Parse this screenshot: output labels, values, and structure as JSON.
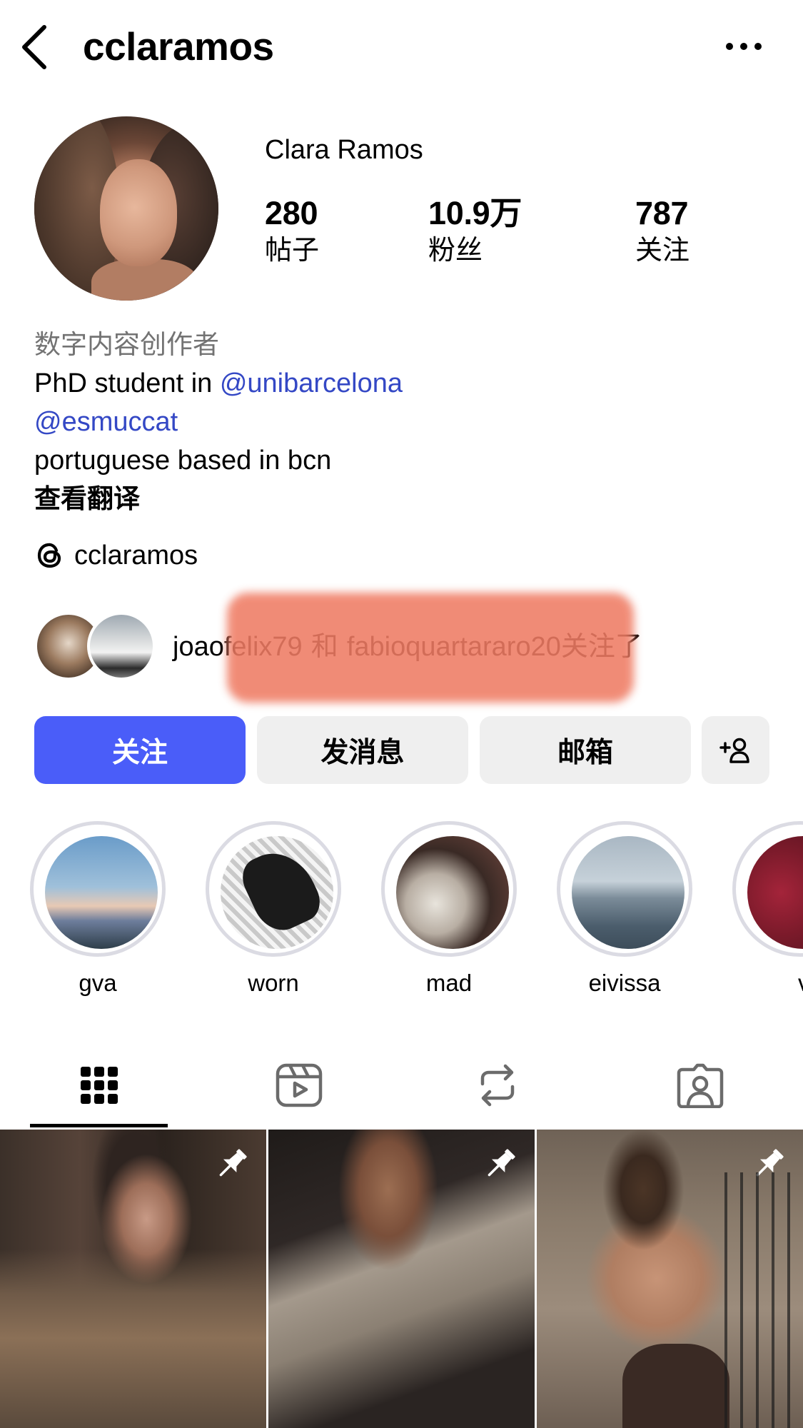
{
  "header": {
    "username": "cclaramos",
    "back_icon": "chevron-left-icon",
    "more_icon": "more-horizontal-icon"
  },
  "profile": {
    "display_name": "Clara Ramos",
    "stats": {
      "posts": {
        "value": "280",
        "label": "帖子"
      },
      "followers": {
        "value": "10.9万",
        "label": "粉丝"
      },
      "following": {
        "value": "787",
        "label": "关注"
      }
    }
  },
  "bio": {
    "category": "数字内容创作者",
    "line1_prefix": "PhD student in ",
    "mention1": "@unibarcelona",
    "mention2": "@esmuccat",
    "line3": "portuguese based in bcn",
    "translate": "查看翻译"
  },
  "threads": {
    "handle": "cclaramos",
    "icon": "threads-icon"
  },
  "followed_by": {
    "user1": "joaofelix79",
    "joiner": " 和 ",
    "user2": "fabioquartararo20",
    "suffix": "关注了"
  },
  "actions": {
    "follow": "关注",
    "message": "发消息",
    "email": "邮箱",
    "add_user_icon": "add-user-icon"
  },
  "highlights": [
    {
      "label": "gva"
    },
    {
      "label": "worn"
    },
    {
      "label": "mad"
    },
    {
      "label": "eivissa"
    },
    {
      "label": "vita"
    }
  ],
  "tabs": [
    {
      "icon": "grid-icon",
      "active": true
    },
    {
      "icon": "reels-icon",
      "active": false
    },
    {
      "icon": "reposts-icon",
      "active": false
    },
    {
      "icon": "tagged-icon",
      "active": false
    }
  ],
  "colors": {
    "follow_button": "#4a5df9",
    "mention": "#3448c5",
    "secondary_button": "#efefef",
    "muted_text": "#737373",
    "redaction": "#ef7c64"
  }
}
